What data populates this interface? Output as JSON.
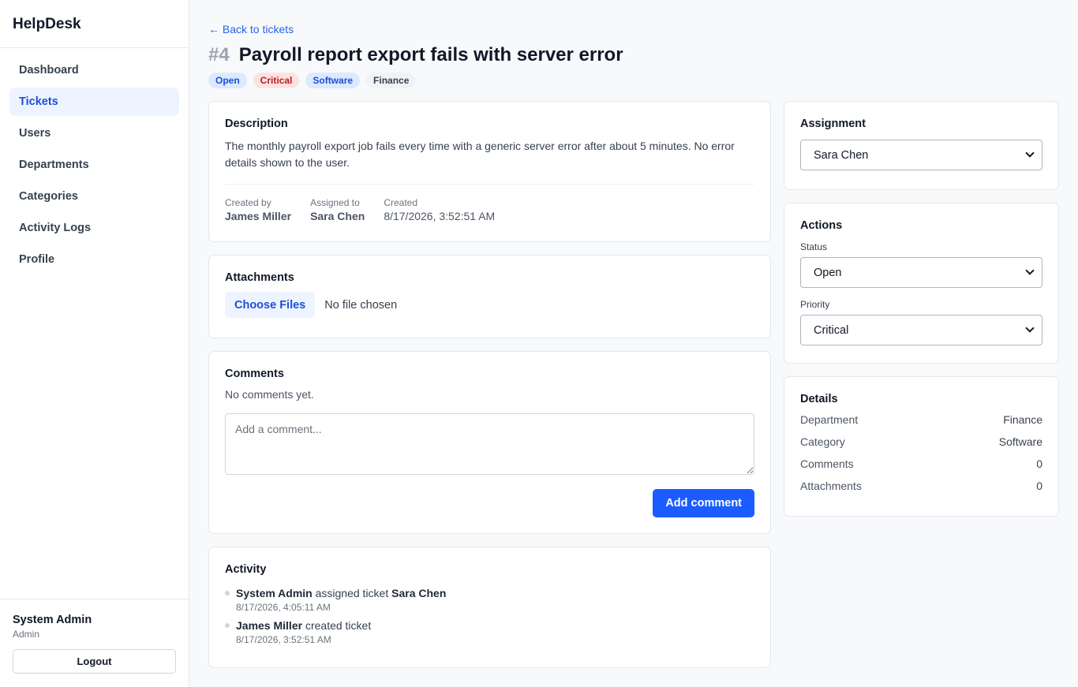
{
  "app": {
    "name": "HelpDesk"
  },
  "sidebar": {
    "items": [
      {
        "label": "Dashboard"
      },
      {
        "label": "Tickets",
        "active": true
      },
      {
        "label": "Users"
      },
      {
        "label": "Departments"
      },
      {
        "label": "Categories"
      },
      {
        "label": "Activity Logs"
      },
      {
        "label": "Profile"
      }
    ],
    "user": {
      "name": "System Admin",
      "role": "Admin"
    },
    "logout_label": "Logout"
  },
  "ticket": {
    "back_label": "← Back to tickets",
    "number": "#4",
    "title": "Payroll report export fails with server error",
    "badges": {
      "status": "Open",
      "priority": "Critical",
      "category": "Software",
      "department": "Finance"
    }
  },
  "description": {
    "heading": "Description",
    "text": "The monthly payroll export job fails every time with a generic server error after about 5 minutes. No error details shown to the user.",
    "meta": {
      "created_by_label": "Created by",
      "created_by": "James Miller",
      "assigned_to_label": "Assigned to",
      "assigned_to": "Sara Chen",
      "created_label": "Created",
      "created": "8/17/2026, 3:52:51 AM"
    }
  },
  "attachments": {
    "heading": "Attachments",
    "choose_label": "Choose Files",
    "no_file": "No file chosen"
  },
  "comments": {
    "heading": "Comments",
    "empty": "No comments yet.",
    "placeholder": "Add a comment...",
    "add_label": "Add comment"
  },
  "activity": {
    "heading": "Activity",
    "items": [
      {
        "actor": "System Admin",
        "action": "assigned ticket",
        "target": "Sara Chen",
        "time": "8/17/2026, 4:05:11 AM"
      },
      {
        "actor": "James Miller",
        "action": "created ticket",
        "target": "",
        "time": "8/17/2026, 3:52:51 AM"
      }
    ]
  },
  "assignment": {
    "heading": "Assignment",
    "selected": "Sara Chen"
  },
  "actions": {
    "heading": "Actions",
    "status_label": "Status",
    "status_selected": "Open",
    "priority_label": "Priority",
    "priority_selected": "Critical"
  },
  "details": {
    "heading": "Details",
    "rows": [
      {
        "label": "Department",
        "value": "Finance"
      },
      {
        "label": "Category",
        "value": "Software"
      },
      {
        "label": "Comments",
        "value": "0"
      },
      {
        "label": "Attachments",
        "value": "0"
      }
    ]
  },
  "colors": {
    "accent": "#1a5cff",
    "link": "#2563eb",
    "critical_bg": "#fee2e2",
    "critical_text": "#b91c1c"
  }
}
